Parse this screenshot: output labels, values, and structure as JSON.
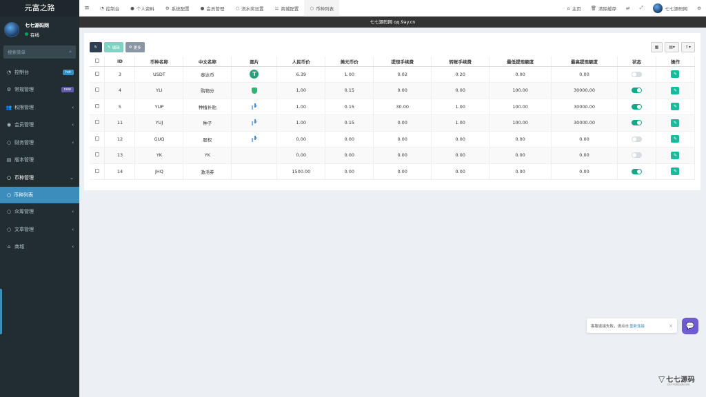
{
  "sidebar": {
    "brand": "元富之路",
    "user_name": "七七源码网",
    "user_status": "在线",
    "search_placeholder": "搜索菜单",
    "items": [
      {
        "label": "控制台",
        "icon": "dashboard-icon",
        "glyph": "◔",
        "badge": "hot"
      },
      {
        "label": "常规管理",
        "icon": "cogs-icon",
        "glyph": "⚙",
        "badge": "new"
      },
      {
        "label": "权限管理",
        "icon": "group-icon",
        "glyph": "👥",
        "chevron": "‹"
      },
      {
        "label": "会员管理",
        "icon": "user-circle-icon",
        "glyph": "◉",
        "chevron": "‹"
      },
      {
        "label": "财务管理",
        "icon": "circle-icon",
        "glyph": "○",
        "chevron": "‹"
      },
      {
        "label": "版本管理",
        "icon": "list-icon",
        "glyph": "▤"
      },
      {
        "label": "币种管理",
        "icon": "circle-icon",
        "glyph": "○",
        "chevron": "⌄"
      },
      {
        "label": "众筹管理",
        "icon": "circle-icon",
        "glyph": "○",
        "chevron": "‹"
      },
      {
        "label": "文章管理",
        "icon": "circle-icon",
        "glyph": "○",
        "chevron": "‹"
      },
      {
        "label": "商城",
        "icon": "home-icon",
        "glyph": "⌂",
        "chevron": "‹"
      }
    ],
    "submenu_active": "币种列表"
  },
  "topnav": {
    "tabs": [
      {
        "label": "控制台",
        "icon": "dashboard-icon",
        "glyph": "◔"
      },
      {
        "label": "个人资料",
        "icon": "user-icon",
        "glyph": "●"
      },
      {
        "label": "系统配置",
        "icon": "cog-icon",
        "glyph": "⚙"
      },
      {
        "label": "会员管理",
        "icon": "user-icon",
        "glyph": "●"
      },
      {
        "label": "流水奖设置",
        "icon": "circle-icon",
        "glyph": "○"
      },
      {
        "label": "商城配置",
        "icon": "sliders-icon",
        "glyph": "⚌"
      },
      {
        "label": "币种列表",
        "icon": "circle-icon",
        "glyph": "○"
      }
    ],
    "home": "主页",
    "clear_cache": "清除缓存",
    "username": "七七源码网"
  },
  "banner": "七七源码网 qq.9ay.cn",
  "toolbar": {
    "edit": "编辑",
    "more": "更多"
  },
  "table": {
    "headers": [
      "ID",
      "币种名称",
      "中文名称",
      "图片",
      "人民币价",
      "美元币价",
      "提现手续费",
      "转账手续费",
      "最低提现额度",
      "最高提现额度",
      "状态",
      "操作"
    ],
    "rows": [
      {
        "id": "3",
        "code": "USDT",
        "name": "泰达币",
        "image": "tether-icon",
        "cny": "6.39",
        "usd": "1.00",
        "withdraw_fee": "0.02",
        "transfer_fee": "0.20",
        "min": "0.00",
        "max": "0.00",
        "status": "off"
      },
      {
        "id": "4",
        "code": "YLI",
        "name": "购物分",
        "image": "shield-icon",
        "cny": "1.00",
        "usd": "0.15",
        "withdraw_fee": "0.00",
        "transfer_fee": "0.00",
        "min": "100.00",
        "max": "30000.00",
        "status": "on"
      },
      {
        "id": "5",
        "code": "YUP",
        "name": "种植补贴",
        "image": "pixel-icon",
        "cny": "1.00",
        "usd": "0.15",
        "withdraw_fee": "30.00",
        "transfer_fee": "1.00",
        "min": "100.00",
        "max": "30000.00",
        "status": "on"
      },
      {
        "id": "11",
        "code": "YUJ",
        "name": "种子",
        "image": "pixel-icon",
        "cny": "1.00",
        "usd": "0.15",
        "withdraw_fee": "0.00",
        "transfer_fee": "1.00",
        "min": "100.00",
        "max": "30000.00",
        "status": "on"
      },
      {
        "id": "12",
        "code": "GUQ",
        "name": "股权",
        "image": "pixel-icon",
        "cny": "0.00",
        "usd": "0.00",
        "withdraw_fee": "0.00",
        "transfer_fee": "0.00",
        "min": "0.00",
        "max": "0.00",
        "status": "off"
      },
      {
        "id": "13",
        "code": "YK",
        "name": "YK",
        "image": "",
        "cny": "0.00",
        "usd": "0.00",
        "withdraw_fee": "0.00",
        "transfer_fee": "0.00",
        "min": "0.00",
        "max": "0.00",
        "status": "off"
      },
      {
        "id": "14",
        "code": "JHQ",
        "name": "激活券",
        "image": "",
        "cny": "1500.00",
        "usd": "0.00",
        "withdraw_fee": "0.00",
        "transfer_fee": "0.00",
        "min": "0.00",
        "max": "0.00",
        "status": "on"
      }
    ]
  },
  "notice": {
    "text": "客服连接失败，请点击",
    "link": "重新连接"
  },
  "watermark": {
    "text": "七七源码",
    "sub": "万兵千号源码资源分享网"
  },
  "colors": {
    "sidebar_bg": "#222d32",
    "accent": "#3c8dbc",
    "toggle_on": "#18a689",
    "action": "#18bc9c"
  }
}
